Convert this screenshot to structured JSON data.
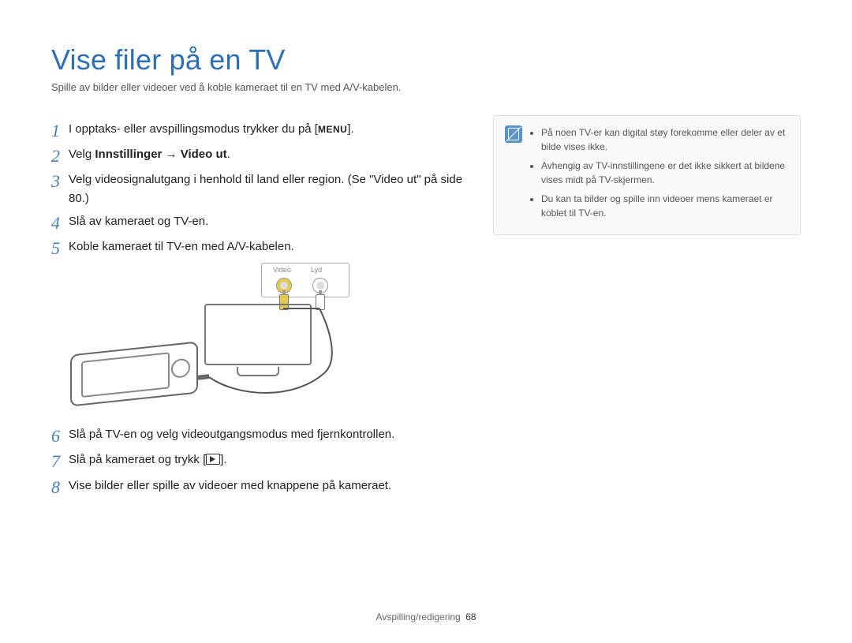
{
  "title": "Vise filer på en TV",
  "subtitle": "Spille av bilder eller videoer ved å koble kameraet til en TV med A/V-kabelen.",
  "steps": {
    "s1_pre": "I opptaks- eller avspillingsmodus trykker du på [",
    "s1_menu": "MENU",
    "s1_post": "].",
    "s2_pre": "Velg ",
    "s2_bold": "Innstillinger → Video ut",
    "s2_post": ".",
    "s3": "Velg videosignalutgang i henhold til land eller region. (Se \"Video ut\" på side 80.)",
    "s4": "Slå av kameraet og TV-en.",
    "s5": "Koble kameraet til TV-en med A/V-kabelen.",
    "s6": "Slå på TV-en og velg videoutgangsmodus med fjernkontrollen.",
    "s7_pre": "Slå på kameraet og trykk [",
    "s7_post": "].",
    "s8": "Vise bilder eller spille av videoer med knappene på kameraet."
  },
  "nums": {
    "n1": "1",
    "n2": "2",
    "n3": "3",
    "n4": "4",
    "n5": "5",
    "n6": "6",
    "n7": "7",
    "n8": "8"
  },
  "illus": {
    "video": "Video",
    "lyd": "Lyd"
  },
  "note": {
    "b1": "På noen TV-er kan digital støy forekomme eller deler av et bilde vises ikke.",
    "b2": "Avhengig av TV-innstillingene er det ikke sikkert at bildene vises midt på TV-skjermen.",
    "b3": "Du kan ta bilder og spille inn videoer mens kameraet er koblet til TV-en."
  },
  "footer": {
    "section": "Avspilling/redigering",
    "page": "68"
  }
}
